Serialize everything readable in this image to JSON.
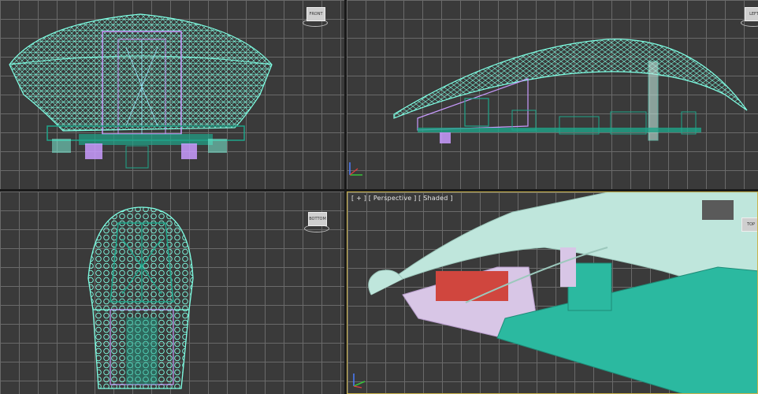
{
  "viewports": {
    "front": {
      "viewcube_label": "FRONT"
    },
    "left": {
      "viewcube_label": "LEFT"
    },
    "bottom": {
      "viewcube_label": "BOTTOM"
    },
    "perspective": {
      "label": "[ + ] [ Perspective ] [ Shaded ]",
      "viewcube_label": "TOP"
    }
  },
  "colors": {
    "wire_cyan": "#7fffe4",
    "wire_magenta": "#c99bff",
    "wire_green": "#1fa58a",
    "shaded_shell": "#bfe6dc",
    "shaded_base": "#2bb9a0",
    "shaded_pink": "#d8c6e6",
    "shaded_red": "#d0463e",
    "active_border": "#c9b24a"
  },
  "icons": [
    "axis-tripod-icon",
    "viewcube-icon"
  ]
}
